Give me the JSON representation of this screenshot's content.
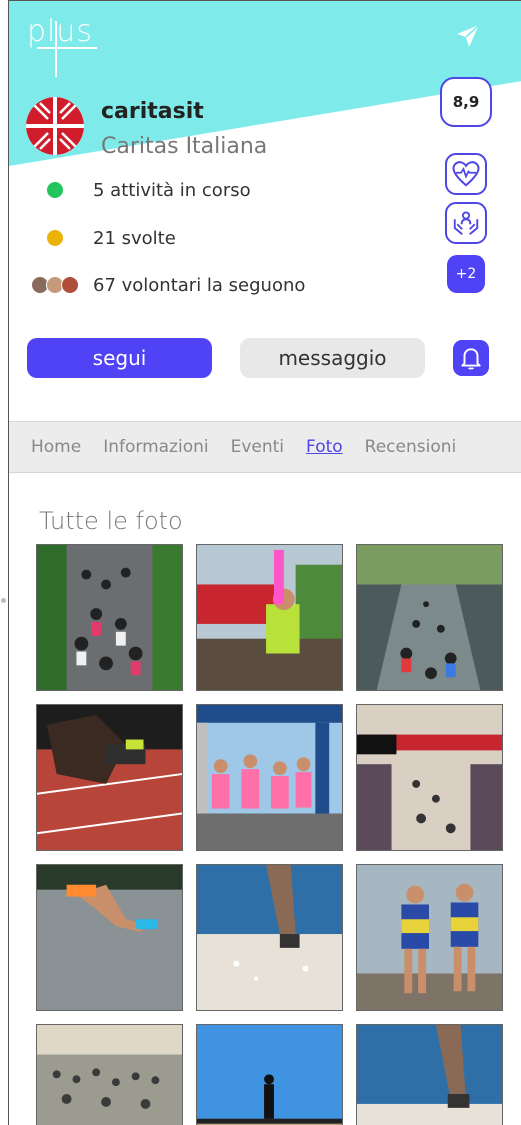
{
  "app": {
    "logo_text": "plus"
  },
  "colors": {
    "accent": "#5043f5",
    "header_bg": "#7eeaea",
    "green": "#22c55e",
    "yellow": "#eab308"
  },
  "profile": {
    "handle": "caritasit",
    "name": "Caritas Italiana",
    "rating": "8,9",
    "stats": {
      "active": "5 attività in corso",
      "done": "21 svolte",
      "volunteers": "67 volontari la seguono"
    },
    "badges": [
      {
        "icon": "heart-pulse-icon"
      },
      {
        "icon": "helping-hands-icon"
      }
    ],
    "more_badges": "+2"
  },
  "actions": {
    "follow": "segui",
    "message": "messaggio",
    "notify_icon": "bell-icon"
  },
  "tabs": [
    {
      "label": "Home",
      "active": false
    },
    {
      "label": "Informazioni",
      "active": false
    },
    {
      "label": "Eventi",
      "active": false
    },
    {
      "label": "Foto",
      "active": true
    },
    {
      "label": "Recensioni",
      "active": false
    }
  ],
  "gallery": {
    "title": "Tutte le foto",
    "photos": [
      {
        "subject": "marathon-crowd-street"
      },
      {
        "subject": "runner-cheering-finish"
      },
      {
        "subject": "runners-underpass"
      },
      {
        "subject": "sprinter-starting-blocks"
      },
      {
        "subject": "runners-half-marathon-arch"
      },
      {
        "subject": "marathon-finish-line-crowd"
      },
      {
        "subject": "runner-on-road"
      },
      {
        "subject": "runner-feet-water"
      },
      {
        "subject": "two-marathon-runners"
      },
      {
        "subject": "crowd-city-square"
      },
      {
        "subject": "runner-on-bridge"
      },
      {
        "subject": "runner-legs-closeup"
      }
    ]
  }
}
